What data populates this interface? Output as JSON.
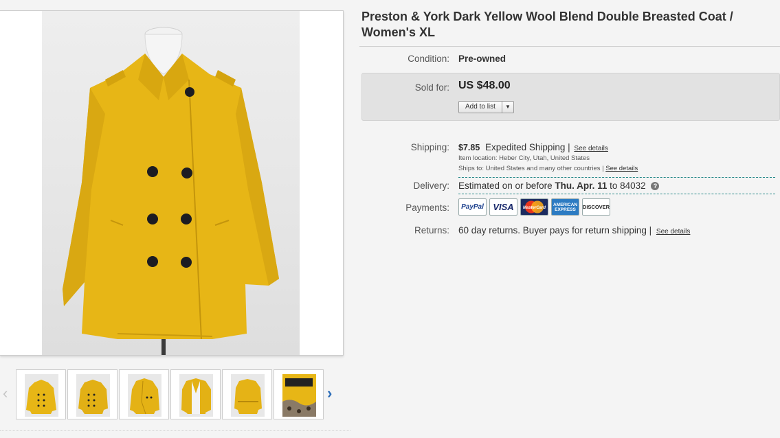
{
  "product": {
    "title": "Preston & York Dark Yellow Wool Blend Double Breasted Coat / Women's XL",
    "main_image_icon": "coat-photo",
    "colors": {
      "coat": "#e7b616",
      "coat_shadow": "#c99a0e",
      "button": "#1c1c22",
      "link_arrow": "#2b6cb8"
    }
  },
  "thumbnails": [
    {
      "icon": "coat-front-thumb"
    },
    {
      "icon": "coat-angle-thumb"
    },
    {
      "icon": "coat-open-thumb"
    },
    {
      "icon": "coat-side-thumb"
    },
    {
      "icon": "coat-back-thumb"
    },
    {
      "icon": "coat-label-thumb"
    }
  ],
  "details": {
    "condition_label": "Condition:",
    "condition_value": "Pre-owned",
    "sold_label": "Sold for:",
    "price": "US $48.00",
    "add_to_list": "Add to list",
    "shipping_label": "Shipping:",
    "shipping_cost": "$7.85",
    "shipping_method": "Expedited Shipping |",
    "shipping_see_details": "See details",
    "item_location": "Item location:  Heber City, Utah, United States",
    "ships_to": "Ships to:  United States and many other countries |",
    "ships_to_see_details": "See details",
    "delivery_label": "Delivery:",
    "delivery_prefix": "Estimated on or before",
    "delivery_date": "Thu. Apr. 11",
    "delivery_to": "to 84032",
    "payments_label": "Payments:",
    "payments": [
      "PayPal",
      "VISA",
      "MasterCard",
      "AMERICAN EXPRESS",
      "DISCOVER"
    ],
    "returns_label": "Returns:",
    "returns_text": "60 day returns. Buyer pays for return shipping |",
    "returns_see_details": "See details"
  }
}
